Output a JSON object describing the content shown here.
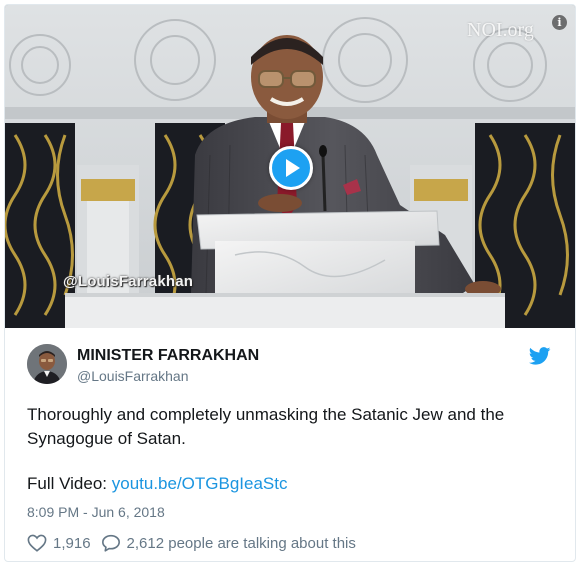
{
  "media": {
    "watermark": "@LouisFarrakhan",
    "logo": "NOI.org",
    "info_glyph": "i",
    "play_icon": "play-icon"
  },
  "tweet": {
    "display_name": "MINISTER FARRAKHAN",
    "handle": "@LouisFarrakhan",
    "text": "Thoroughly and completely unmasking the Satanic Jew and the Synagogue of Satan.",
    "video_prefix": "Full Video: ",
    "video_link": "youtu.be/OTGBgIeaStc",
    "timestamp": "8:09 PM - Jun 6, 2018",
    "likes": "1,916",
    "talking": "2,612 people are talking about this"
  },
  "colors": {
    "accent": "#1da1f2",
    "link": "#1b95e0",
    "text": "#14171a",
    "muted": "#657786",
    "border": "#e1e8ed"
  }
}
